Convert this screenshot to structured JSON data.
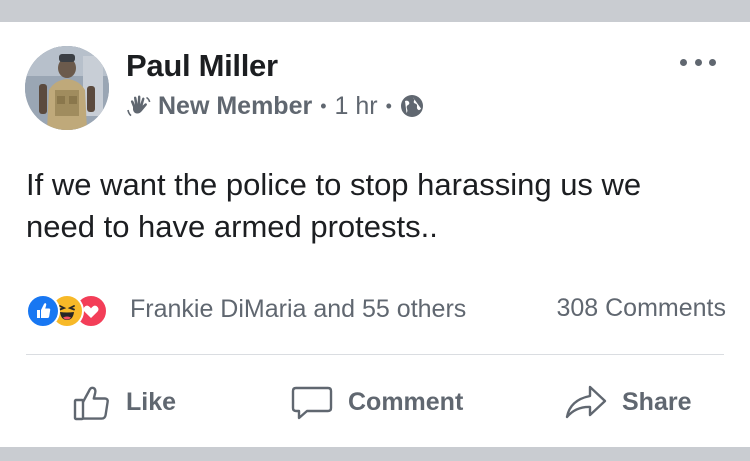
{
  "post": {
    "author": "Paul Miller",
    "badge": "New Member",
    "time": "1 hr",
    "separator": "•",
    "privacy_icon": "globe-icon",
    "text": "If we want the police to stop harassing us we need to have armed protests..",
    "reactions": {
      "icons": [
        "like-reaction-icon",
        "haha-reaction-icon",
        "love-reaction-icon"
      ],
      "summary": "Frankie DiMaria and 55 others"
    },
    "comments": "308 Comments"
  },
  "actions": {
    "like": "Like",
    "comment": "Comment",
    "share": "Share"
  },
  "colors": {
    "like_blue": "#1877f2",
    "haha_yellow": "#f7b928",
    "love_red": "#f33e58",
    "secondary_text": "#606770",
    "primary_text": "#1c1e21"
  }
}
